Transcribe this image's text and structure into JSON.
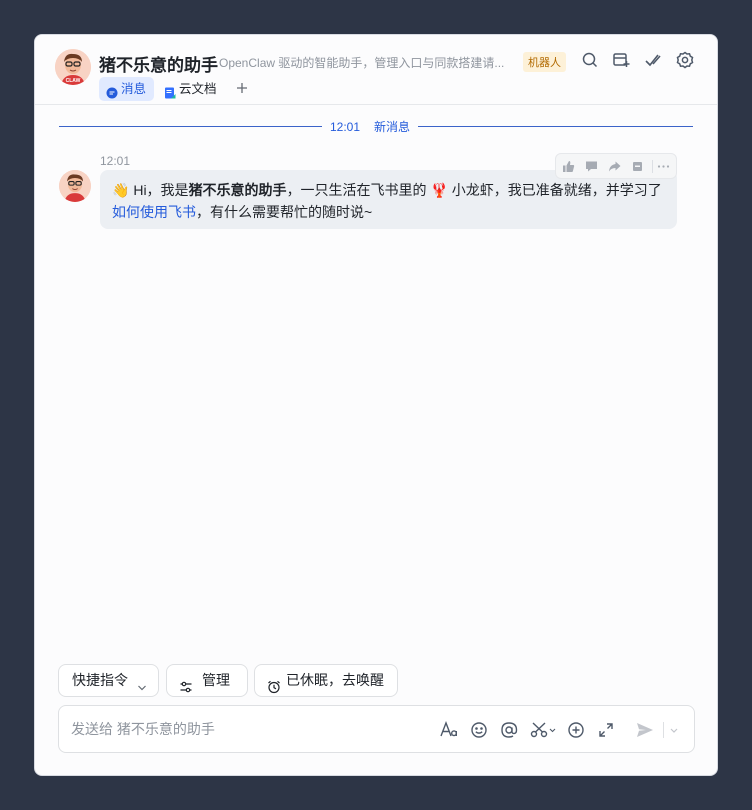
{
  "chat": {
    "name": "猪不乐意的助手",
    "description": "OpenClaw 驱动的智能助手，管理入口与同款搭建请...",
    "badge": "机器人",
    "avatar_label": "CLAW"
  },
  "header_actions": [
    {
      "icon": "search-chat-icon"
    },
    {
      "icon": "add-to-group-icon"
    },
    {
      "icon": "task-check-icon"
    },
    {
      "icon": "settings-gear-icon"
    }
  ],
  "tabs": [
    {
      "label": "消息",
      "icon": "message-bubble-icon",
      "active": true
    },
    {
      "label": "云文档",
      "icon": "cloud-doc-icon",
      "active": false
    }
  ],
  "divider": {
    "time": "12:01",
    "label": "新消息"
  },
  "message": {
    "time": "12:01",
    "wave_emoji": "👋",
    "part1": " Hi，我是",
    "bold": "猪不乐意的助手",
    "part2": "，一只生活在飞书里的 ",
    "lobster_emoji": "🦞",
    "part3": " 小龙虾，我已准备就绪，并学习了",
    "link": "如何使用飞书",
    "part4": "，有什么需要帮忙的随时说~"
  },
  "message_toolbar": [
    {
      "icon": "thumbs-up-icon"
    },
    {
      "icon": "reply-icon"
    },
    {
      "icon": "forward-icon"
    },
    {
      "icon": "pin-icon"
    },
    {
      "icon": "more-icon"
    }
  ],
  "quick_actions": [
    {
      "label": "快捷指令",
      "icon": "chevron-down-icon"
    },
    {
      "label": "管理",
      "icon": "sliders-icon"
    },
    {
      "label": "已休眠，去唤醒",
      "icon": "alarm-clock-icon"
    }
  ],
  "composer": {
    "placeholder": "发送给 猪不乐意的助手",
    "tools": [
      "text-format-icon",
      "emoji-icon",
      "mention-icon",
      "screenshot-scissors-icon",
      "add-circle-icon",
      "expand-icon",
      "send-icon",
      "send-options-chevron-icon"
    ]
  },
  "colors": {
    "accent": "#245bdb",
    "background": "#2d3546",
    "bubble": "#eceff3",
    "badge_bg": "#fdf1d8",
    "badge_text": "#b26a00"
  }
}
